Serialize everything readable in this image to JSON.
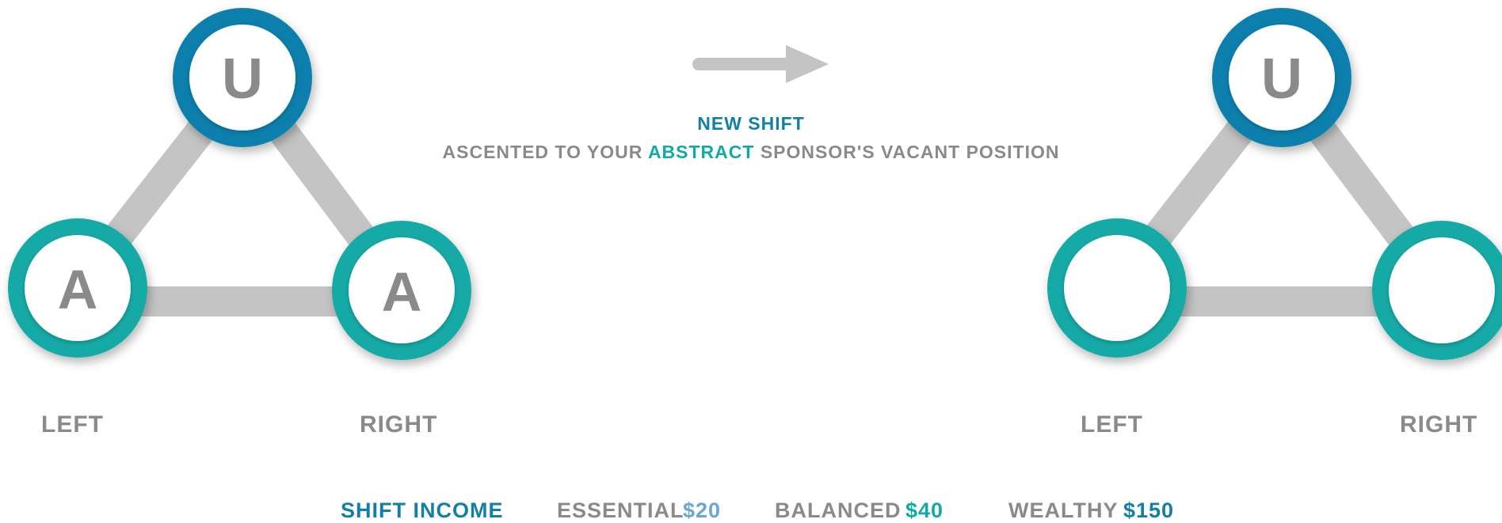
{
  "colors": {
    "upline_ring": "#0f7fad",
    "abstract_ring": "#13aaa7",
    "connector": "#c4c4c4",
    "label_gray": "#8a8a8a",
    "arrow": "#c4c4c4"
  },
  "left_triangle": {
    "top_node_letter": "U",
    "left_node_letter": "A",
    "right_node_letter": "A",
    "left_label": "LEFT",
    "right_label": "RIGHT"
  },
  "right_triangle": {
    "top_node_letter": "U",
    "left_node_letter": "",
    "right_node_letter": "",
    "left_label": "LEFT",
    "right_label": "RIGHT"
  },
  "transition": {
    "arrow_icon": "right-arrow-icon",
    "title": "NEW SHIFT",
    "subtitle_before": "ASCENTED TO YOUR",
    "subtitle_accent": "ABSTRACT",
    "subtitle_after": "SPONSOR'S VACANT POSITION"
  },
  "income": {
    "title": "SHIFT INCOME",
    "tiers": [
      {
        "name": "ESSENTIAL",
        "value": "$20"
      },
      {
        "name": "BALANCED",
        "value": "$40"
      },
      {
        "name": "WEALTHY",
        "value": "$150"
      }
    ]
  }
}
